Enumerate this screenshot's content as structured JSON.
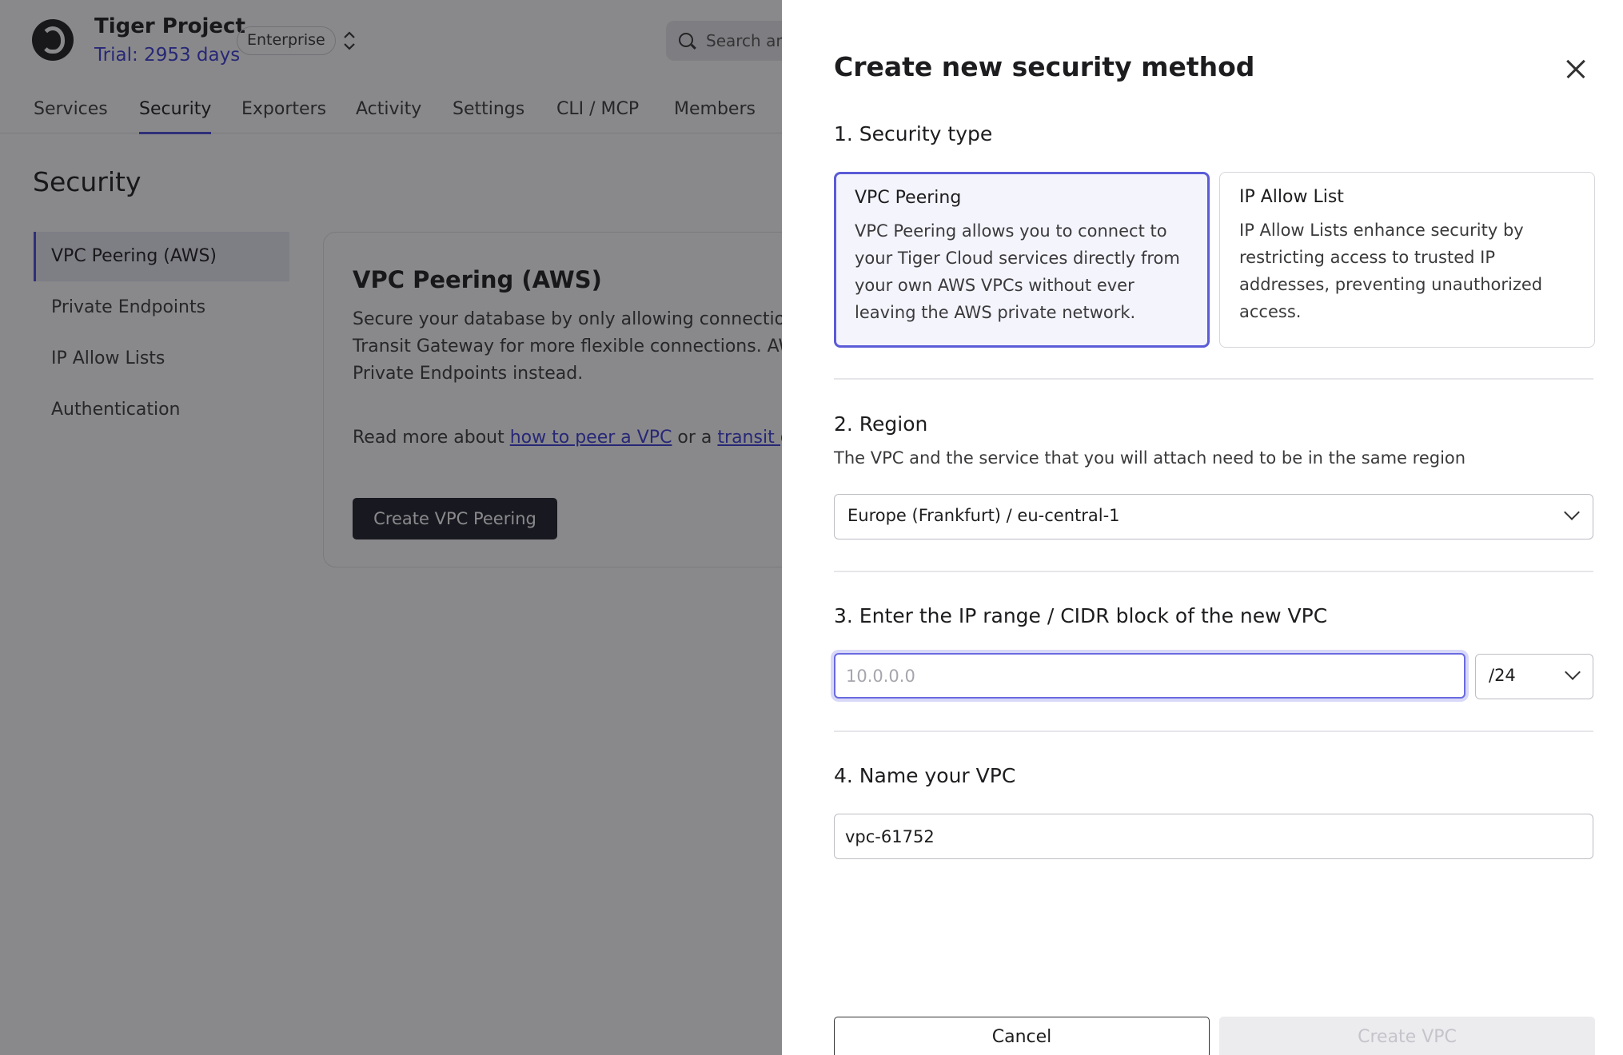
{
  "app": {
    "project_name": "Tiger Project",
    "trial": "Trial: 2953 days",
    "plan_badge": "Enterprise",
    "search_placeholder": "Search an"
  },
  "nav": {
    "tabs": [
      {
        "label": "Services"
      },
      {
        "label": "Security",
        "active": true
      },
      {
        "label": "Exporters"
      },
      {
        "label": "Activity"
      },
      {
        "label": "Settings"
      },
      {
        "label": "CLI / MCP"
      },
      {
        "label": "Members"
      }
    ]
  },
  "page": {
    "title": "Security",
    "sidebar": [
      {
        "label": "VPC Peering (AWS)",
        "active": true
      },
      {
        "label": "Private Endpoints"
      },
      {
        "label": "IP Allow Lists"
      },
      {
        "label": "Authentication"
      }
    ],
    "card": {
      "title": "VPC Peering (AWS)",
      "desc_line1": "Secure your database by only allowing connection",
      "desc_line2": "Transit Gateway for more flexible connections. AW",
      "desc_line3": "Private Endpoints instead.",
      "read_prefix": "Read more about ",
      "link1": "how to peer a VPC",
      "read_mid": " or a ",
      "link2": "transit ga",
      "button": "Create VPC Peering"
    }
  },
  "drawer": {
    "title": "Create new security method",
    "section1": {
      "label": "1. Security type",
      "options": [
        {
          "title": "VPC Peering",
          "description": "VPC Peering allows you to connect to your Tiger Cloud services directly from your own AWS VPCs without ever leaving the AWS private network.",
          "selected": true
        },
        {
          "title": "IP Allow List",
          "description": "IP Allow Lists enhance security by restricting access to trusted IP addresses, preventing unauthorized access.",
          "selected": false
        }
      ]
    },
    "section2": {
      "label": "2. Region",
      "help": "The VPC and the service that you will attach need to be in the same region",
      "selected_region": "Europe (Frankfurt) / eu-central-1"
    },
    "section3": {
      "label": "3. Enter the IP range / CIDR block of the new VPC",
      "ip_placeholder": "10.0.0.0",
      "ip_value": "",
      "cidr_suffix": "/24"
    },
    "section4": {
      "label": "4. Name your VPC",
      "vpc_name": "vpc-61752"
    },
    "buttons": {
      "cancel": "Cancel",
      "create": "Create VPC"
    }
  },
  "colors": {
    "accent": "#4b4bd8",
    "link": "#3b3bd6",
    "selected_card_bg": "#f4f4fd",
    "primary_button": "#1d1d2b",
    "disabled_button": "#ececef"
  },
  "icons": [
    "logo-icon",
    "switch-project-icon",
    "search-icon",
    "close-icon",
    "chevron-down-icon"
  ]
}
